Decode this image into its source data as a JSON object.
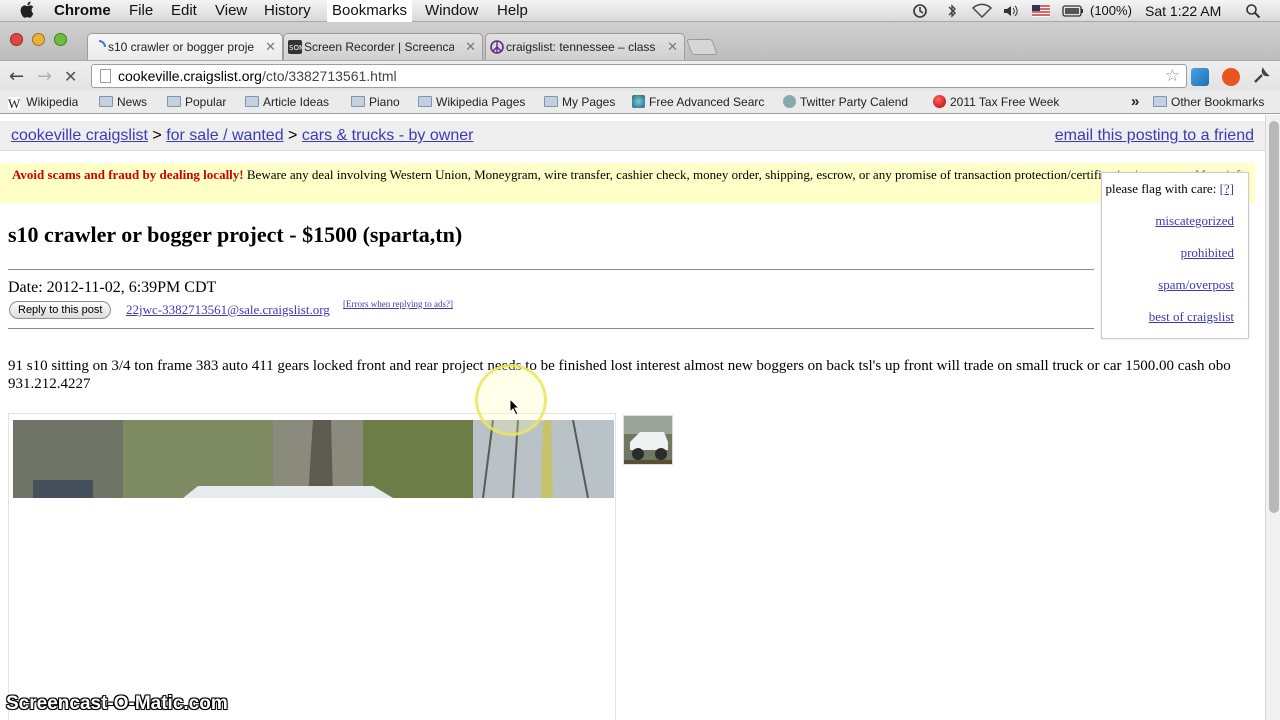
{
  "menubar": {
    "items": [
      "Chrome",
      "File",
      "Edit",
      "View",
      "History",
      "Bookmarks",
      "Window",
      "Help"
    ],
    "battery": "(100%)",
    "clock": "Sat 1:22 AM"
  },
  "tabs": [
    {
      "title": "s10 crawler or bogger proje",
      "icon": "loading-spinner-icon"
    },
    {
      "title": "Screen Recorder | Screencast",
      "icon": "som-logo-icon"
    },
    {
      "title": "craigslist: tennessee – classi",
      "icon": "peace-sign-icon"
    }
  ],
  "toolbar": {
    "url_host": "cookeville.craigslist.org",
    "url_path": "/cto/3382713561.html"
  },
  "bookmarks": [
    {
      "label": "Wikipedia",
      "icon": "wikipedia-icon"
    },
    {
      "label": "News",
      "icon": "folder-icon"
    },
    {
      "label": "Popular",
      "icon": "folder-icon"
    },
    {
      "label": "Article Ideas",
      "icon": "folder-icon"
    },
    {
      "label": "Piano",
      "icon": "folder-icon"
    },
    {
      "label": "Wikipedia Pages",
      "icon": "folder-icon"
    },
    {
      "label": "My Pages",
      "icon": "folder-icon"
    },
    {
      "label": "Free Advanced Searc",
      "icon": "globe-icon"
    },
    {
      "label": "Twitter Party Calend",
      "icon": "gear-icon"
    },
    {
      "label": "2011 Tax Free Week",
      "icon": "red-ball-icon"
    }
  ],
  "bookmarks_more": "»",
  "bookmarks_other": "Other Bookmarks",
  "page": {
    "breadcrumb": {
      "site": "cookeville craigslist",
      "sep1": ">",
      "section": "for sale / wanted",
      "sep2": ">",
      "category": "cars & trucks - by owner"
    },
    "email_link": "email this posting to a friend",
    "warning": {
      "bold": "Avoid scams and fraud by dealing locally!",
      "text": " Beware any deal involving Western Union, Moneygram, wire transfer, cashier check, money order, shipping, escrow, or any promise of transaction protection/certification/guarantee. ",
      "link": "More info"
    },
    "flag": {
      "heading": "please flag with care: ",
      "help": "[?]",
      "options": [
        "miscategorized",
        "prohibited",
        "spam/overpost",
        "best of craigslist"
      ]
    },
    "title": "s10 crawler or bogger project - $1500 (sparta,tn)",
    "date": "Date: 2012-11-02, 6:39PM CDT",
    "reply_button": "Reply to this post",
    "reply_email": "22jwc-3382713561@sale.craigslist.org",
    "errors_link": "[Errors when replying to ads?]",
    "body": "91 s10 sitting on 3/4 ton frame 383 auto 411 gears locked front and rear project needs to be finished lost interest almost new boggers on back tsl's up front will trade on small truck or car 1500.00 cash obo 931.212.4227"
  },
  "watermark": "Screencast-O-Matic.com"
}
